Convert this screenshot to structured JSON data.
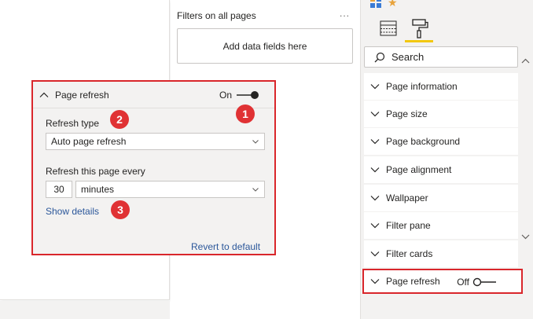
{
  "filters_pane": {
    "title": "Filters on all pages",
    "more": "...",
    "add_fields": "Add data fields here"
  },
  "format_pane": {
    "search_label": "Search",
    "sections": [
      {
        "label": "Page information"
      },
      {
        "label": "Page size"
      },
      {
        "label": "Page background"
      },
      {
        "label": "Page alignment"
      },
      {
        "label": "Wallpaper"
      },
      {
        "label": "Filter pane"
      },
      {
        "label": "Filter cards"
      }
    ],
    "page_refresh": {
      "label": "Page refresh",
      "state": "Off"
    }
  },
  "refresh_card": {
    "title": "Page refresh",
    "toggle_state": "On",
    "refresh_type_label": "Refresh type",
    "refresh_type_value": "Auto page refresh",
    "interval_label": "Refresh this page every",
    "interval_value": "30",
    "interval_unit": "minutes",
    "show_details": "Show details",
    "revert": "Revert to default"
  },
  "callouts": [
    "1",
    "2",
    "3"
  ],
  "colors": {
    "highlight": "#d9262b",
    "badge": "#e03234",
    "link": "#2b579a",
    "accent": "#f2c811"
  }
}
